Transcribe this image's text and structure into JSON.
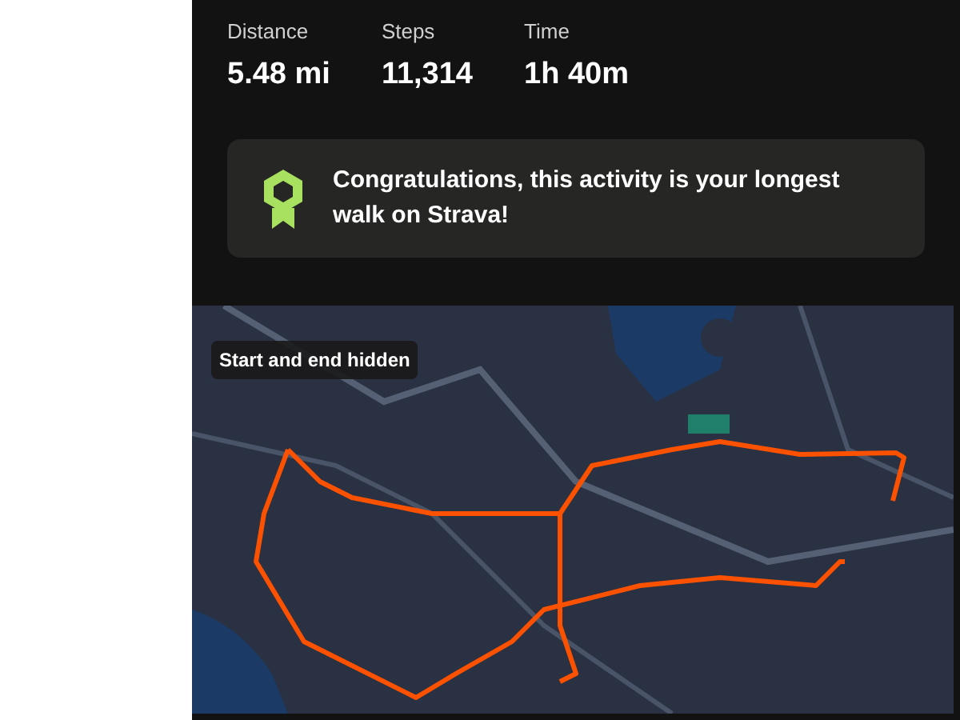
{
  "stats": [
    {
      "label": "Distance",
      "value": "5.48 mi"
    },
    {
      "label": "Steps",
      "value": "11,314"
    },
    {
      "label": "Time",
      "value": "1h 40m"
    }
  ],
  "achievement": {
    "text": "Congratulations, this activity is your longest walk on Strava!"
  },
  "map": {
    "kind": "picture",
    "badge": "Start and end hidden"
  }
}
